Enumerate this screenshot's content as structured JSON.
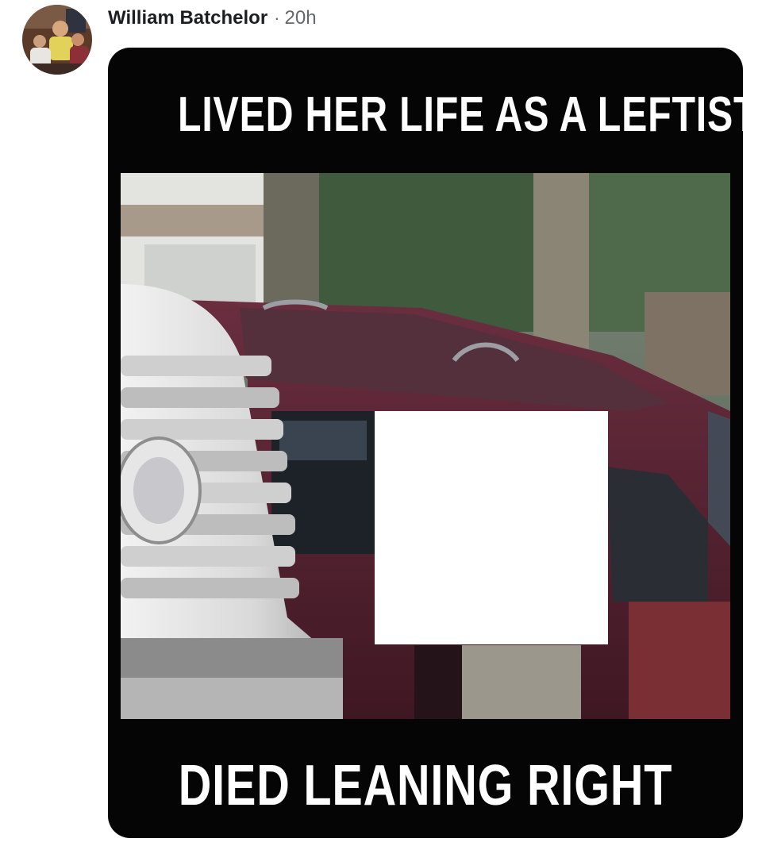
{
  "post": {
    "author": "William Batchelor",
    "separator": "·",
    "time": "20h"
  },
  "meme": {
    "top_caption": "LIVED HER LIFE AS A LEFTIST",
    "bottom_caption": "DIED LEANING RIGHT"
  },
  "colors": {
    "card_background": "#050505",
    "caption_text": "#ffffff",
    "author_text": "#1c1e21",
    "meta_text": "#65676b",
    "car_paint": "#5a2333",
    "redaction_box": "#ffffff"
  },
  "icons": {
    "avatar": "profile-photo"
  }
}
